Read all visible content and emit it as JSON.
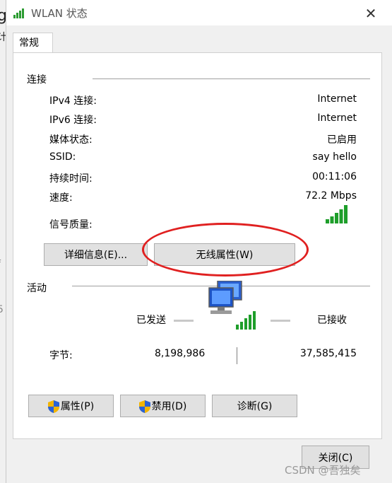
{
  "window": {
    "title": "WLAN 状态",
    "close_glyph": "✕"
  },
  "tabs": [
    {
      "label": "常规"
    }
  ],
  "connection": {
    "header": "连接",
    "rows": [
      {
        "label": "IPv4 连接:",
        "value": "Internet"
      },
      {
        "label": "IPv6 连接:",
        "value": "Internet"
      },
      {
        "label": "媒体状态:",
        "value": "已启用"
      },
      {
        "label": "SSID:",
        "value": "say hello"
      },
      {
        "label": "持续时间:",
        "value": "00:11:06"
      },
      {
        "label": "速度:",
        "value": "72.2 Mbps"
      }
    ],
    "signal_label": "信号质量:",
    "signal_bars": 5,
    "details_button": "详细信息(E)...",
    "wireless_props_button": "无线属性(W)"
  },
  "activity": {
    "header": "活动",
    "sent_label": "已发送",
    "received_label": "已接收",
    "bytes_label": "字节:",
    "bytes_sent": "8,198,986",
    "bytes_received": "37,585,415"
  },
  "buttons": {
    "properties": "属性(P)",
    "disable": "禁用(D)",
    "diagnose": "诊断(G)",
    "close": "关闭(C)"
  },
  "annotation": {
    "color": "#e02020",
    "shape": "ellipse"
  },
  "watermark": "CSDN @吾独矣",
  "colors": {
    "signal_green": "#1e9e2a",
    "dialog_bg": "#f0f0f0"
  },
  "icons": [
    "wifi-signal-icon",
    "network-computers-icon",
    "uac-shield-icon"
  ]
}
